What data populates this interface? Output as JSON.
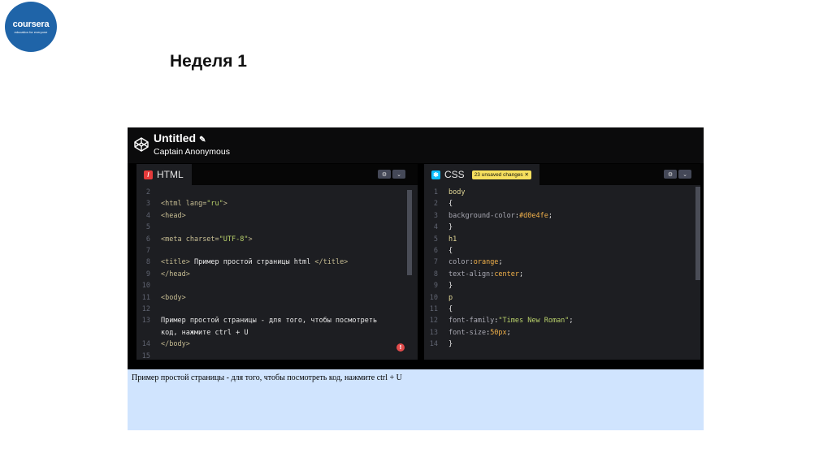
{
  "logo": {
    "word": "coursera",
    "tagline": "education for everyone"
  },
  "slide_title": "Неделя 1",
  "pen": {
    "title": "Untitled",
    "author": "Captain Anonymous"
  },
  "html_tab": {
    "label": "HTML",
    "icon": "html-slash-icon"
  },
  "css_tab": {
    "label": "CSS",
    "icon": "css-star-icon",
    "badge": "23 unsaved changes ✕"
  },
  "controls": {
    "settings": "⚙",
    "collapse": "⌄"
  },
  "html_code": [
    {
      "n": "2",
      "parts": []
    },
    {
      "n": "3",
      "parts": [
        [
          "c-tag",
          "<html "
        ],
        [
          "c-attr",
          "lang="
        ],
        [
          "c-str",
          "\"ru\""
        ],
        [
          "c-tag",
          ">"
        ]
      ]
    },
    {
      "n": "4",
      "parts": [
        [
          "c-tag",
          "<head>"
        ]
      ]
    },
    {
      "n": "5",
      "parts": []
    },
    {
      "n": "6",
      "parts": [
        [
          "c-tag",
          "<meta "
        ],
        [
          "c-attr",
          "charset="
        ],
        [
          "c-str",
          "\"UTF-8\""
        ],
        [
          "c-tag",
          ">"
        ]
      ]
    },
    {
      "n": "7",
      "parts": []
    },
    {
      "n": "8",
      "parts": [
        [
          "c-tag",
          "<title>"
        ],
        [
          "c-plain",
          " Пример простой страницы html "
        ],
        [
          "c-tag",
          "</title>"
        ]
      ]
    },
    {
      "n": "9",
      "parts": [
        [
          "c-tag",
          "</head>"
        ]
      ]
    },
    {
      "n": "10",
      "parts": []
    },
    {
      "n": "11",
      "parts": [
        [
          "c-tag",
          "<body>"
        ]
      ]
    },
    {
      "n": "12",
      "parts": []
    },
    {
      "n": "13",
      "parts": [
        [
          "c-plain",
          "Пример простой страницы - для того, чтобы посмотреть"
        ]
      ]
    },
    {
      "n": "",
      "parts": [
        [
          "c-plain",
          "код, нажмите ctrl + U"
        ]
      ]
    },
    {
      "n": "14",
      "parts": [
        [
          "c-tag",
          "</body>"
        ]
      ]
    },
    {
      "n": "15",
      "parts": []
    }
  ],
  "css_code": [
    {
      "n": "1",
      "parts": [
        [
          "c-sel",
          "body"
        ]
      ]
    },
    {
      "n": "2",
      "parts": [
        [
          "c-plain",
          "{"
        ]
      ]
    },
    {
      "n": "3",
      "parts": [
        [
          "c-prop",
          "background-color"
        ],
        [
          "c-plain",
          ":"
        ],
        [
          "c-val",
          "#d0e4fe"
        ],
        [
          "c-plain",
          ";"
        ]
      ]
    },
    {
      "n": "4",
      "parts": [
        [
          "c-plain",
          "}"
        ]
      ]
    },
    {
      "n": "5",
      "parts": [
        [
          "c-sel",
          "h1"
        ]
      ]
    },
    {
      "n": "6",
      "parts": [
        [
          "c-plain",
          "{"
        ]
      ]
    },
    {
      "n": "7",
      "parts": [
        [
          "c-prop",
          "color"
        ],
        [
          "c-plain",
          ":"
        ],
        [
          "c-val",
          "orange"
        ],
        [
          "c-plain",
          ";"
        ]
      ]
    },
    {
      "n": "8",
      "parts": [
        [
          "c-prop",
          "text-align"
        ],
        [
          "c-plain",
          ":"
        ],
        [
          "c-val",
          "center"
        ],
        [
          "c-plain",
          ";"
        ]
      ]
    },
    {
      "n": "9",
      "parts": [
        [
          "c-plain",
          "}"
        ]
      ]
    },
    {
      "n": "10",
      "parts": [
        [
          "c-sel",
          "p"
        ]
      ]
    },
    {
      "n": "11",
      "parts": [
        [
          "c-plain",
          "{"
        ]
      ]
    },
    {
      "n": "12",
      "parts": [
        [
          "c-prop",
          "font-family"
        ],
        [
          "c-plain",
          ":"
        ],
        [
          "c-str",
          "\"Times New Roman\""
        ],
        [
          "c-plain",
          ";"
        ]
      ]
    },
    {
      "n": "13",
      "parts": [
        [
          "c-prop",
          "font-size"
        ],
        [
          "c-plain",
          ":"
        ],
        [
          "c-val",
          "50px"
        ],
        [
          "c-plain",
          ";"
        ]
      ]
    },
    {
      "n": "14",
      "parts": [
        [
          "c-plain",
          "}"
        ]
      ]
    }
  ],
  "error_badge": "!",
  "preview_text": "Пример простой страницы - для того, чтобы посмотреть код, нажмите ctrl + U",
  "colors": {
    "preview_bg": "#d0e4fe",
    "editor_bg": "#1d1e22",
    "badge": "#f7e05e",
    "html_icon": "#e53b3b",
    "css_icon": "#0ebeff"
  }
}
